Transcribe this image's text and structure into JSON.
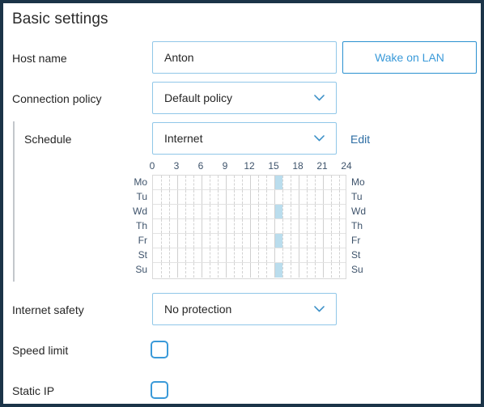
{
  "page": {
    "title": "Basic settings",
    "border_color": "#1b3448",
    "accent_color": "#3a9ad9",
    "field_border_color": "#90c7e8",
    "highlight_color": "#badded"
  },
  "fields": {
    "host_name": {
      "label": "Host name",
      "value": "Anton",
      "placeholder": "Host name"
    },
    "connection_policy": {
      "label": "Connection policy",
      "value": "Default policy",
      "chevron_icon": "chevron-down-icon"
    },
    "schedule": {
      "label": "Schedule",
      "value": "Internet",
      "chevron_icon": "chevron-down-icon",
      "edit_link": "Edit"
    },
    "internet_safety": {
      "label": "Internet safety",
      "value": "No protection",
      "chevron_icon": "chevron-down-icon"
    },
    "speed_limit": {
      "label": "Speed limit",
      "checked": false
    },
    "static_ip": {
      "label": "Static IP",
      "checked": false
    }
  },
  "buttons": {
    "wake_on_lan": "Wake on LAN"
  },
  "schedule_grid": {
    "hour_ticks": [
      0,
      3,
      6,
      9,
      12,
      15,
      18,
      21,
      24
    ],
    "hours_total": 24,
    "days": [
      "Mo",
      "Tu",
      "Wd",
      "Th",
      "Fr",
      "St",
      "Su"
    ],
    "active_cells": {
      "Mo": [
        15
      ],
      "Tu": [],
      "Wd": [
        15
      ],
      "Th": [],
      "Fr": [
        15
      ],
      "St": [],
      "Su": [
        15
      ]
    }
  }
}
